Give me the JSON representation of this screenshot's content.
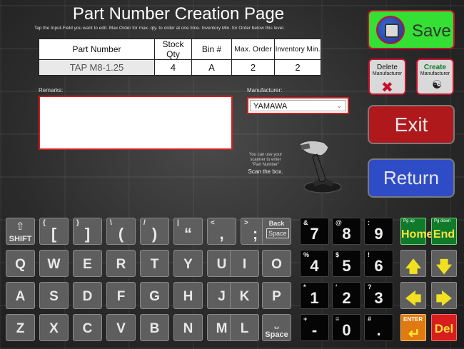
{
  "header": {
    "title": "Part Number Creation Page",
    "instructions": "Tap  the Input-Field you want to edit.   Max.Order for max. qty. to order at one time.  Inventory Min. for Order below this level."
  },
  "table": {
    "headers": [
      "Part Number",
      "Stock Qty",
      "Bin #",
      "Max. Order",
      "Inventory Min."
    ],
    "row": [
      "TAP M8-1.25",
      "4",
      "A",
      "2",
      "2"
    ]
  },
  "remarks": {
    "label": "Remarks:",
    "value": ""
  },
  "manufacturer": {
    "label": "Manufacturer:",
    "selected": "YAMAWA"
  },
  "scanner": {
    "hint_lines": [
      "You can use your",
      "scanner to enter",
      "\"Part Number\""
    ],
    "hint_action": "Scan the box."
  },
  "buttons": {
    "save": "Save",
    "delete_mfr_l1": "Delete",
    "delete_mfr_l2": "Manufacturer",
    "create_mfr_l1": "Create",
    "create_mfr_l2": "Manufacturer",
    "exit": "Exit",
    "return": "Return"
  },
  "icons": {
    "save": "save-disk-icon",
    "delete_manufacturer": "delete-manufacturer-icon",
    "create_manufacturer": "create-manufacturer-icon",
    "scanner": "barcode-scanner-icon"
  },
  "keyboard": {
    "shift": "SHIFT",
    "symbol_keys": [
      {
        "sub": "{",
        "main": "["
      },
      {
        "sub": "}",
        "main": "]"
      },
      {
        "sub": "\\",
        "main": "("
      },
      {
        "sub": "/",
        "main": ")"
      },
      {
        "sub": "|",
        "main": "“"
      },
      {
        "sub": "<",
        "main": ","
      },
      {
        "sub": ">",
        "main": ";"
      }
    ],
    "backspace": "Back",
    "backspace_icon": "Space",
    "row2": [
      "Q",
      "W",
      "E",
      "R",
      "T",
      "Y",
      "U",
      "I",
      "O"
    ],
    "row3": [
      "A",
      "S",
      "D",
      "F",
      "G",
      "H",
      "J",
      "K",
      "P"
    ],
    "row4": [
      "Z",
      "X",
      "C",
      "V",
      "B",
      "N",
      "M",
      "L"
    ],
    "space": "Space",
    "numpad": [
      {
        "sub": "&",
        "main": "7"
      },
      {
        "sub": "@",
        "main": "8"
      },
      {
        "sub": ":",
        "main": "9"
      },
      {
        "sub": "%",
        "main": "4"
      },
      {
        "sub": "$",
        "main": "5"
      },
      {
        "sub": "!",
        "main": "6"
      },
      {
        "sub": "*",
        "main": "1"
      },
      {
        "sub": "‘",
        "main": "2"
      },
      {
        "sub": "?",
        "main": "3"
      },
      {
        "sub": "+",
        "main": "-"
      },
      {
        "sub": "=",
        "main": "0"
      },
      {
        "sub": "#",
        "main": "."
      }
    ],
    "pgup_tag": "Pg up",
    "home": "Home",
    "pgdown_tag": "Pg down",
    "end": "End",
    "enter": "ENTER",
    "del": "Del"
  },
  "colors": {
    "save_bg": "#33e033",
    "exit_bg": "#b0191c",
    "return_bg": "#2f4cc7",
    "accent_red": "#c8102e",
    "nav_green": "#0f7a2a",
    "arrow_yellow": "#f0e020",
    "enter_orange": "#e07a10"
  }
}
